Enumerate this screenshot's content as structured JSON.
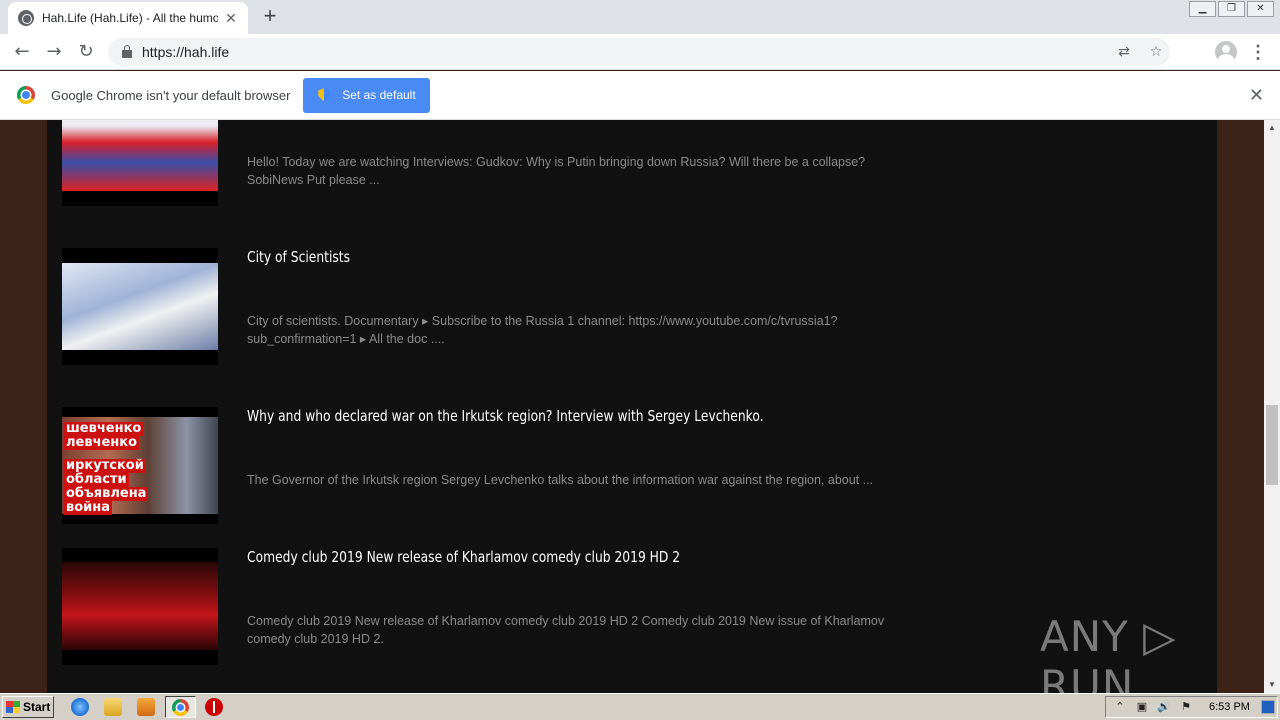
{
  "browser": {
    "tab_title": "Hah.Life (Hah.Life) - All the humor in",
    "tab_close": "✕",
    "new_tab": "+",
    "url": "https://hah.life",
    "win_minimize": "▁",
    "win_restore": "❐",
    "win_close": "✕",
    "nav_back": "←",
    "nav_forward": "→",
    "nav_reload": "↻",
    "translate_icon": "⇄",
    "bookmark_icon": "☆",
    "menu_icon": "⋮"
  },
  "infobar": {
    "message": "Google Chrome isn't your default browser",
    "button_label": "Set as default",
    "close": "✕"
  },
  "items": [
    {
      "title": "",
      "description": "Hello! Today we are watching Interviews: Gudkov: Why is Putin bringing down Russia? Will there be a collapse? SobiNews Put please ..."
    },
    {
      "title": "City of Scientists",
      "description": "City of scientists. Documentary ▸ Subscribe to the Russia 1 channel: https://www.youtube.com/c/tvrussia1?sub_confirmation=1 ▸ All the doc ...."
    },
    {
      "title": "Why and who declared war on the Irkutsk region? Interview with Sergey Levchenko.",
      "description": "The Governor of the Irkutsk region Sergey Levchenko talks about the information war against the region, about ...",
      "thumb_text": [
        "шевченко",
        "левченко",
        "иркутской",
        "области",
        "объявлена",
        "война"
      ]
    },
    {
      "title": "Comedy club 2019 New release of Kharlamov comedy club 2019 HD 2",
      "description": "Comedy club 2019 New release of Kharlamov comedy club 2019 HD 2 Comedy club 2019 New issue of Kharlamov comedy club 2019 HD 2."
    }
  ],
  "watermark": "ANY ▷ RUN",
  "scrollbar": {
    "up": "▲",
    "down": "▼"
  },
  "taskbar": {
    "start_label": "Start",
    "clock": "6:53 PM",
    "tray_icons": [
      "⌃",
      "▣",
      "🔊",
      "⚑"
    ]
  }
}
